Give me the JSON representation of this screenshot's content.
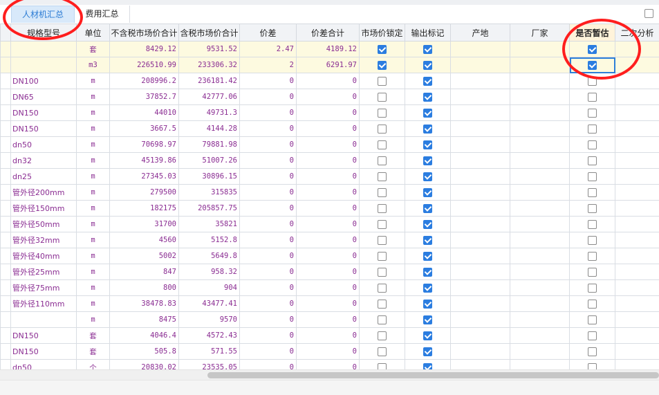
{
  "tabs": [
    {
      "label": "人材机汇总",
      "active": true
    },
    {
      "label": "费用汇总",
      "active": false
    }
  ],
  "columns": {
    "spec": "规格型号",
    "unit": "单位",
    "excl": "不含税市场价合计",
    "incl": "含税市场价合计",
    "diff": "价差",
    "diff_total": "价差合计",
    "lock": "市场价锁定",
    "output": "输出标记",
    "origin": "产地",
    "maker": "厂家",
    "provisional": "是否暂估",
    "secondary": "二次分析"
  },
  "highlighted_column": "是否暂估",
  "colors": {
    "accent": "#2b7de0",
    "annotation": "#ff1e1e",
    "cell_text": "#8a2c92",
    "pinned_row": "#fdfae0"
  },
  "rows": [
    {
      "spec": "",
      "unit": "套",
      "excl": "8429.12",
      "incl": "9531.52",
      "diff": "2.47",
      "diff_total": "4189.12",
      "lock": true,
      "output": true,
      "origin": "",
      "maker": "",
      "provisional": true
    },
    {
      "spec": "",
      "unit": "m3",
      "excl": "226510.99",
      "incl": "233306.32",
      "diff": "2",
      "diff_total": "6291.97",
      "lock": true,
      "output": true,
      "origin": "",
      "maker": "",
      "provisional": true
    },
    {
      "spec": "DN100",
      "unit": "m",
      "excl": "208996.2",
      "incl": "236181.42",
      "diff": "0",
      "diff_total": "0",
      "lock": false,
      "output": true,
      "origin": "",
      "maker": "",
      "provisional": false
    },
    {
      "spec": "DN65",
      "unit": "m",
      "excl": "37852.7",
      "incl": "42777.06",
      "diff": "0",
      "diff_total": "0",
      "lock": false,
      "output": true,
      "origin": "",
      "maker": "",
      "provisional": false
    },
    {
      "spec": "DN150",
      "unit": "m",
      "excl": "44010",
      "incl": "49731.3",
      "diff": "0",
      "diff_total": "0",
      "lock": false,
      "output": true,
      "origin": "",
      "maker": "",
      "provisional": false
    },
    {
      "spec": "DN150",
      "unit": "m",
      "excl": "3667.5",
      "incl": "4144.28",
      "diff": "0",
      "diff_total": "0",
      "lock": false,
      "output": true,
      "origin": "",
      "maker": "",
      "provisional": false
    },
    {
      "spec": "dn50",
      "unit": "m",
      "excl": "70698.97",
      "incl": "79881.98",
      "diff": "0",
      "diff_total": "0",
      "lock": false,
      "output": true,
      "origin": "",
      "maker": "",
      "provisional": false
    },
    {
      "spec": "dn32",
      "unit": "m",
      "excl": "45139.86",
      "incl": "51007.26",
      "diff": "0",
      "diff_total": "0",
      "lock": false,
      "output": true,
      "origin": "",
      "maker": "",
      "provisional": false
    },
    {
      "spec": "dn25",
      "unit": "m",
      "excl": "27345.03",
      "incl": "30896.15",
      "diff": "0",
      "diff_total": "0",
      "lock": false,
      "output": true,
      "origin": "",
      "maker": "",
      "provisional": false
    },
    {
      "spec": "管外径200mm",
      "unit": "m",
      "excl": "279500",
      "incl": "315835",
      "diff": "0",
      "diff_total": "0",
      "lock": false,
      "output": true,
      "origin": "",
      "maker": "",
      "provisional": false
    },
    {
      "spec": "管外径150mm",
      "unit": "m",
      "excl": "182175",
      "incl": "205857.75",
      "diff": "0",
      "diff_total": "0",
      "lock": false,
      "output": true,
      "origin": "",
      "maker": "",
      "provisional": false
    },
    {
      "spec": "管外径50mm",
      "unit": "m",
      "excl": "31700",
      "incl": "35821",
      "diff": "0",
      "diff_total": "0",
      "lock": false,
      "output": true,
      "origin": "",
      "maker": "",
      "provisional": false
    },
    {
      "spec": "管外径32mm",
      "unit": "m",
      "excl": "4560",
      "incl": "5152.8",
      "diff": "0",
      "diff_total": "0",
      "lock": false,
      "output": true,
      "origin": "",
      "maker": "",
      "provisional": false
    },
    {
      "spec": "管外径40mm",
      "unit": "m",
      "excl": "5002",
      "incl": "5649.8",
      "diff": "0",
      "diff_total": "0",
      "lock": false,
      "output": true,
      "origin": "",
      "maker": "",
      "provisional": false
    },
    {
      "spec": "管外径25mm",
      "unit": "m",
      "excl": "847",
      "incl": "958.32",
      "diff": "0",
      "diff_total": "0",
      "lock": false,
      "output": true,
      "origin": "",
      "maker": "",
      "provisional": false
    },
    {
      "spec": "管外径75mm",
      "unit": "m",
      "excl": "800",
      "incl": "904",
      "diff": "0",
      "diff_total": "0",
      "lock": false,
      "output": true,
      "origin": "",
      "maker": "",
      "provisional": false
    },
    {
      "spec": "管外径110mm",
      "unit": "m",
      "excl": "38478.83",
      "incl": "43477.41",
      "diff": "0",
      "diff_total": "0",
      "lock": false,
      "output": true,
      "origin": "",
      "maker": "",
      "provisional": false
    },
    {
      "spec": "",
      "unit": "m",
      "excl": "8475",
      "incl": "9570",
      "diff": "0",
      "diff_total": "0",
      "lock": false,
      "output": true,
      "origin": "",
      "maker": "",
      "provisional": false
    },
    {
      "spec": "DN150",
      "unit": "套",
      "excl": "4046.4",
      "incl": "4572.43",
      "diff": "0",
      "diff_total": "0",
      "lock": false,
      "output": true,
      "origin": "",
      "maker": "",
      "provisional": false
    },
    {
      "spec": "DN150",
      "unit": "套",
      "excl": "505.8",
      "incl": "571.55",
      "diff": "0",
      "diff_total": "0",
      "lock": false,
      "output": true,
      "origin": "",
      "maker": "",
      "provisional": false
    },
    {
      "spec": "dn50",
      "unit": "个",
      "excl": "20830.02",
      "incl": "23535.05",
      "diff": "0",
      "diff_total": "0",
      "lock": false,
      "output": true,
      "origin": "",
      "maker": "",
      "provisional": false
    }
  ]
}
